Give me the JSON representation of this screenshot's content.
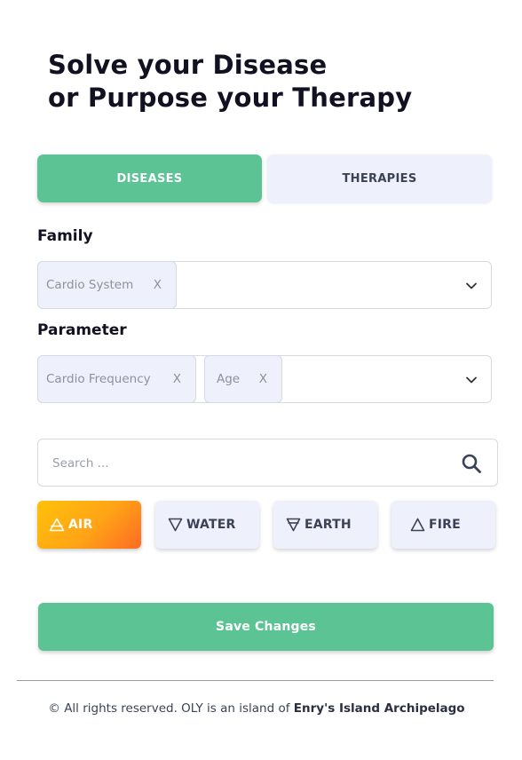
{
  "title": {
    "line1": "Solve your Disease",
    "line2": "or Purpose your Therapy"
  },
  "tabs": [
    {
      "label": "DISEASES",
      "active": true
    },
    {
      "label": "THERAPIES",
      "active": false
    }
  ],
  "family": {
    "label": "Family",
    "chips": [
      {
        "text": "Cardio System",
        "remove": "X"
      }
    ]
  },
  "parameter": {
    "label": "Parameter",
    "chips": [
      {
        "text": "Cardio Frequency",
        "remove": "X"
      },
      {
        "text": "Age",
        "remove": "X"
      }
    ]
  },
  "search": {
    "placeholder": "Search ...",
    "value": ""
  },
  "elements": [
    {
      "label": "AIR",
      "icon": "air-symbol-icon",
      "active": true
    },
    {
      "label": "WATER",
      "icon": "water-symbol-icon",
      "active": false
    },
    {
      "label": "EARTH",
      "icon": "earth-symbol-icon",
      "active": false
    },
    {
      "label": "FIRE",
      "icon": "fire-symbol-icon",
      "active": false
    }
  ],
  "save_label": "Save Changes",
  "footer": {
    "text": "© All rights reserved. OLY is an island of",
    "brand": "Enry's Island Archipelago"
  },
  "colors": {
    "primary_green": "#5bc394",
    "tab_inactive_bg": "#eef0fb",
    "air_gradient_start": "#ffc10a",
    "air_gradient_end": "#ff6b24",
    "text_dark": "#111122"
  }
}
